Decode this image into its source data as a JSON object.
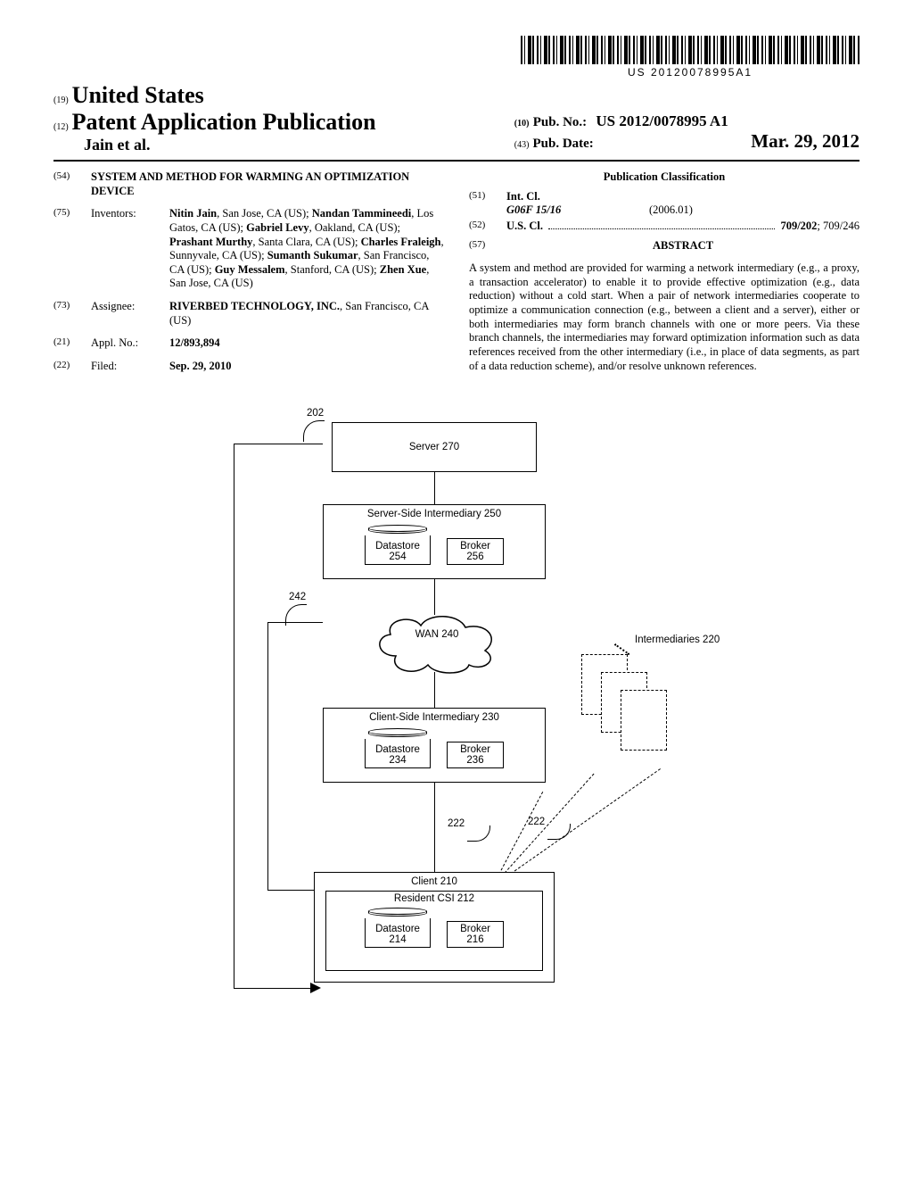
{
  "barcode_number": "US 20120078995A1",
  "header": {
    "country_prefix": "(19)",
    "country": "United States",
    "type_prefix": "(12)",
    "type": "Patent Application Publication",
    "authors": "Jain et al.",
    "pubno_prefix": "(10)",
    "pubno_label": "Pub. No.:",
    "pubno": "US 2012/0078995 A1",
    "pubdate_prefix": "(43)",
    "pubdate_label": "Pub. Date:",
    "pubdate": "Mar. 29, 2012"
  },
  "fields": {
    "title_num": "(54)",
    "title": "SYSTEM AND METHOD FOR WARMING AN OPTIMIZATION DEVICE",
    "inventors_num": "(75)",
    "inventors_label": "Inventors:",
    "inventors_html": "<b>Nitin Jain</b>, San Jose, CA (US); <b>Nandan Tammineedi</b>, Los Gatos, CA (US); <b>Gabriel Levy</b>, Oakland, CA (US); <b>Prashant Murthy</b>, Santa Clara, CA (US); <b>Charles Fraleigh</b>, Sunnyvale, CA (US); <b>Sumanth Sukumar</b>, San Francisco, CA (US); <b>Guy Messalem</b>, Stanford, CA (US); <b>Zhen Xue</b>, San Jose, CA (US)",
    "assignee_num": "(73)",
    "assignee_label": "Assignee:",
    "assignee_html": "<b>RIVERBED TECHNOLOGY, INC.</b>, San Francisco, CA (US)",
    "applno_num": "(21)",
    "applno_label": "Appl. No.:",
    "applno": "12/893,894",
    "filed_num": "(22)",
    "filed_label": "Filed:",
    "filed": "Sep. 29, 2010"
  },
  "classification": {
    "heading": "Publication Classification",
    "intcl_num": "(51)",
    "intcl_label": "Int. Cl.",
    "intcl_code": "G06F 15/16",
    "intcl_date": "(2006.01)",
    "uscl_num": "(52)",
    "uscl_label": "U.S. Cl.",
    "uscl_bold": "709/202",
    "uscl_rest": "; 709/246",
    "abstract_num": "(57)",
    "abstract_label": "ABSTRACT",
    "abstract_body": "A system and method are provided for warming a network intermediary (e.g., a proxy, a transaction accelerator) to enable it to provide effective optimization (e.g., data reduction) without a cold start. When a pair of network intermediaries cooperate to optimize a communication connection (e.g., between a client and a server), either or both intermediaries may form branch channels with one or more peers. Via these branch channels, the intermediaries may forward optimization information such as data references received from the other intermediary (i.e., in place of data segments, as part of a data reduction scheme), and/or resolve unknown references."
  },
  "figure": {
    "ref_202": "202",
    "server": "Server 270",
    "ssi": "Server-Side Intermediary 250",
    "ds254": "Datastore 254",
    "broker256": "Broker 256",
    "ref_242": "242",
    "wan": "WAN 240",
    "csi": "Client-Side Intermediary 230",
    "ds234": "Datastore 234",
    "broker236": "Broker 236",
    "intermediaries": "Intermediaries 220",
    "ref_222a": "222",
    "ref_222b": "222",
    "client": "Client 210",
    "resident": "Resident CSI 212",
    "ds214": "Datastore 214",
    "broker216": "Broker 216"
  },
  "chart_data": {
    "type": "diagram",
    "description": "Network topology figure showing Server 270 connected to Server-Side Intermediary 250 (containing Datastore 254 and Broker 256), linked via WAN 240 to Client-Side Intermediary 230 (Datastore 234, Broker 236), linked to Client 210 which hosts Resident CSI 212 (Datastore 214, Broker 216). Dashed branch-channel links 222 connect the client/intermediary to a stack of peer Intermediaries 220. A side arc labeled 202/242 spans the server-to-client path.",
    "nodes": [
      {
        "id": "server270",
        "label": "Server 270"
      },
      {
        "id": "ssi250",
        "label": "Server-Side Intermediary 250",
        "children": [
          "ds254",
          "broker256"
        ]
      },
      {
        "id": "ds254",
        "label": "Datastore 254"
      },
      {
        "id": "broker256",
        "label": "Broker 256"
      },
      {
        "id": "wan240",
        "label": "WAN 240"
      },
      {
        "id": "csi230",
        "label": "Client-Side Intermediary 230",
        "children": [
          "ds234",
          "broker236"
        ]
      },
      {
        "id": "ds234",
        "label": "Datastore 234"
      },
      {
        "id": "broker236",
        "label": "Broker 236"
      },
      {
        "id": "client210",
        "label": "Client 210",
        "children": [
          "rcsi212"
        ]
      },
      {
        "id": "rcsi212",
        "label": "Resident CSI 212",
        "children": [
          "ds214",
          "broker216"
        ]
      },
      {
        "id": "ds214",
        "label": "Datastore 214"
      },
      {
        "id": "broker216",
        "label": "Broker 216"
      },
      {
        "id": "intermediaries220",
        "label": "Intermediaries 220"
      }
    ],
    "edges": [
      {
        "from": "server270",
        "to": "ssi250"
      },
      {
        "from": "ssi250",
        "to": "wan240"
      },
      {
        "from": "wan240",
        "to": "csi230"
      },
      {
        "from": "csi230",
        "to": "client210"
      },
      {
        "from": "client210",
        "to": "intermediaries220",
        "style": "dashed",
        "label": "222"
      },
      {
        "from": "csi230",
        "to": "intermediaries220",
        "style": "dashed",
        "label": "222"
      }
    ],
    "leaders": [
      {
        "label": "202",
        "points_to": "overall-system-arc"
      },
      {
        "label": "242",
        "points_to": "wan-arc"
      }
    ]
  }
}
